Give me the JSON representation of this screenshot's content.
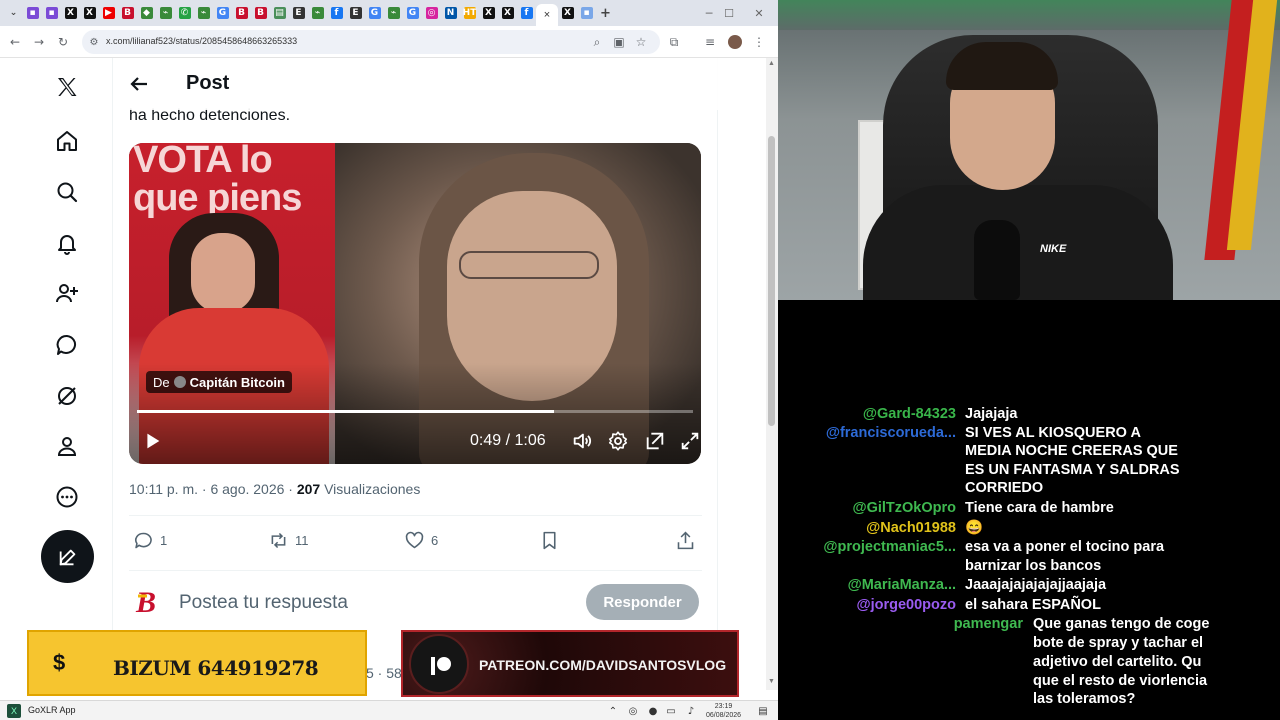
{
  "browser": {
    "url": "x.com/lilianaf523/status/2085458648663265333",
    "tab_icons": [
      "bookmark-icon",
      "bookmark-icon",
      "x-logo-icon",
      "x-logo-icon",
      "youtube-icon",
      "b-icon",
      "app-icon",
      "link-icon",
      "whatsapp-icon",
      "link-icon",
      "gmail-icon",
      "b-icon",
      "b-icon",
      "docs-icon",
      "e-icon",
      "link-icon",
      "facebook-icon",
      "e-icon",
      "gmail-icon",
      "link-icon",
      "gmail-icon",
      "instagram-icon",
      "news-icon",
      "ht-icon",
      "x-logo-icon",
      "x-logo-icon",
      "facebook-icon"
    ],
    "active_tab_close": "×",
    "new_tab": "+"
  },
  "x": {
    "post_title": "Post",
    "tweet_text": "ha hecho detenciones.",
    "video": {
      "source_prefix": "De",
      "source_name": "Capitán Bitcoin",
      "banner_text": "VOTA lo\nque piens",
      "time": "0:49 / 1:06",
      "progress": 0.75
    },
    "meta": {
      "time": "10:11 p. m. · 6 ago. 2026 · ",
      "views_count": "207",
      "views_label": "Visualizaciones"
    },
    "actions": {
      "replies": "1",
      "reposts": "11",
      "likes": "6"
    },
    "reply_placeholder": "Postea tu respuesta",
    "reply_button": "Responder",
    "below_partial": "5 · 58"
  },
  "banners": {
    "bizum_icon": "$",
    "bizum": "BIZUM 644919278",
    "patreon": "PATREON.COM/DAVIDSANTOSVLOG"
  },
  "taskbar": {
    "app_label": "GoXLR App",
    "time": "23:19",
    "date": "06/08/2026"
  },
  "webcam": {
    "shirt_logo": "NIKE"
  },
  "chat": [
    {
      "user": "@Gard-84323",
      "text": "Jajajaja",
      "user_color": "#39b54a"
    },
    {
      "user": "@franciscorueda...",
      "text": "SI VES AL KIOSQUERO A",
      "user_color": "#2d6ad6"
    },
    {
      "user": "",
      "text": "MEDIA NOCHE CREERAS QUE",
      "user_color": "#ffffff"
    },
    {
      "user": "",
      "text": "ES UN FANTASMA Y SALDRAS",
      "user_color": "#ffffff"
    },
    {
      "user": "",
      "text": "CORRIEDO",
      "user_color": "#ffffff"
    },
    {
      "user": "@GilTzOkOpro",
      "text": "Tiene cara de hambre",
      "user_color": "#3fb950"
    },
    {
      "user": "@Nach01988",
      "text": "😄",
      "user_color": "#e0c21a"
    },
    {
      "user": "@projectmaniac5...",
      "text": "esa va a poner el tocino para",
      "user_color": "#3fb950"
    },
    {
      "user": "",
      "text": "barnizar los bancos",
      "user_color": "#ffffff"
    },
    {
      "user": "@MariaManza...",
      "text": "Jaaajajajajajajjaajaja",
      "user_color": "#3fb950"
    },
    {
      "user": "@jorge00pozo",
      "text": "el sahara ESPAÑOL",
      "user_color": "#9a5cf0"
    },
    {
      "user": "pamengar",
      "text": "Que ganas tengo de coge",
      "user_color": "#3fb950"
    },
    {
      "user": "",
      "text": "bote de spray y tachar el",
      "user_color": "#ffffff"
    },
    {
      "user": "",
      "text": "adjetivo del cartelito. Qu",
      "user_color": "#ffffff"
    },
    {
      "user": "",
      "text": "que el resto de viorlencia",
      "user_color": "#ffffff"
    },
    {
      "user": "",
      "text": "las toleramos?",
      "user_color": "#ffffff"
    }
  ]
}
